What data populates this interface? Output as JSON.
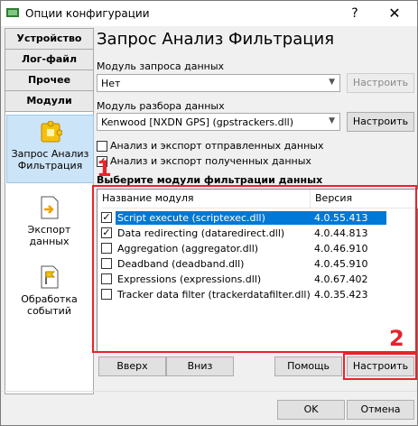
{
  "window": {
    "title": "Опции конфигурации",
    "help": "?",
    "close": "✕"
  },
  "sidebar": {
    "tabs": [
      "Устройство",
      "Лог-файл",
      "Прочее",
      "Модули"
    ],
    "items": [
      {
        "label": "Запрос Анализ Фильтрация",
        "icon": "filter-puzzle-icon",
        "selected": true
      },
      {
        "label": "Экспорт данных",
        "icon": "export-icon",
        "selected": false
      },
      {
        "label": "Обработка событий",
        "icon": "event-flag-icon",
        "selected": false
      }
    ]
  },
  "panel": {
    "title": "Запрос Анализ Фильтрация",
    "query_label": "Модуль запроса данных",
    "query_value": "Нет",
    "query_config": "Настроить",
    "parse_label": "Модуль разбора данных",
    "parse_value": "Kenwood [NXDN GPS] (gpstrackers.dll)",
    "parse_config": "Настроить",
    "chk_sent": "Анализ и экспорт отправленных данных",
    "chk_recv": "Анализ и экспорт полученных данных",
    "filter_label": "Выберите модули фильтрации данных",
    "columns": {
      "name": "Название модуля",
      "version": "Версия"
    },
    "rows": [
      {
        "name": "Script execute (scriptexec.dll)",
        "version": "4.0.55.413",
        "checked": true,
        "selected": true
      },
      {
        "name": "Data redirecting (dataredirect.dll)",
        "version": "4.0.44.813",
        "checked": true,
        "selected": false
      },
      {
        "name": "Aggregation (aggregator.dll)",
        "version": "4.0.46.910",
        "checked": false,
        "selected": false
      },
      {
        "name": "Deadband (deadband.dll)",
        "version": "4.0.45.910",
        "checked": false,
        "selected": false
      },
      {
        "name": "Expressions (expressions.dll)",
        "version": "4.0.67.402",
        "checked": false,
        "selected": false
      },
      {
        "name": "Tracker data filter (trackerdatafilter.dll)",
        "version": "4.0.35.423",
        "checked": false,
        "selected": false
      }
    ],
    "btn_up": "Вверх",
    "btn_down": "Вниз",
    "btn_help": "Помощь",
    "btn_config": "Настроить"
  },
  "footer": {
    "ok": "OK",
    "cancel": "Отмена"
  },
  "annotations": {
    "one": "1",
    "two": "2"
  },
  "colors": {
    "annotation": "#e8232a",
    "selection": "#0078d7"
  }
}
